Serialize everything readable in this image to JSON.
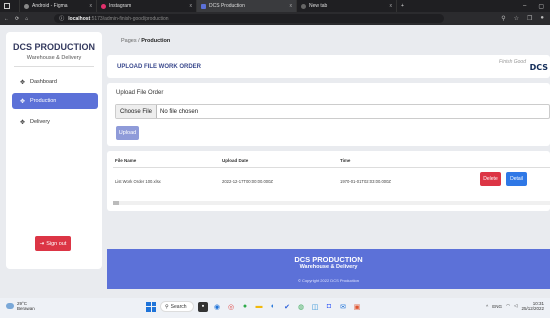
{
  "browser": {
    "tabs": [
      {
        "label": "Android - Figma",
        "close": "x",
        "color": "#888"
      },
      {
        "label": "Instagram",
        "close": "x",
        "color": "#e1306c"
      },
      {
        "label": "DCS Production",
        "close": "x",
        "color": "#5c71d8"
      },
      {
        "label": "New tab",
        "close": "x",
        "color": "#666"
      }
    ],
    "new_tab": "+",
    "url_host": "localhost",
    "url_path": ":5173/admin-finish-good/production",
    "win_minimize": "–",
    "win_maximize": "▢"
  },
  "sidebar": {
    "brand_title": "DCS PRODUCTION",
    "brand_subtitle": "Warehouse & Delivery",
    "items": [
      {
        "label": "Dashboard",
        "icon": "cube-icon"
      },
      {
        "label": "Production",
        "icon": "cube-icon"
      },
      {
        "label": "Delivery",
        "icon": "cube-icon"
      }
    ],
    "signout_label": "Sign out"
  },
  "breadcrumb": {
    "root": "Pages",
    "sep": " / ",
    "current": "Production"
  },
  "header": {
    "title": "UPLOAD FILE WORK ORDER",
    "finish_good": "Finish Good",
    "logo_text": "DCS"
  },
  "upload": {
    "label": "Upload File Order",
    "choose_button": "Choose File",
    "no_file": "No file chosen",
    "upload_button": "Upload"
  },
  "table": {
    "columns": [
      "File Name",
      "Upload Date",
      "Time"
    ],
    "rows": [
      {
        "file_name": "List Work Order 100.xlsx",
        "upload_date": "2022-12-17T00:00:00.000Z",
        "time": "1970-01-01T02:03:00.000Z"
      }
    ],
    "delete_label": "Delete",
    "detail_label": "Detail"
  },
  "footer": {
    "title": "DCS PRODUCTION",
    "subtitle": "Warehouse & Delivery",
    "copyright": "© Copyright 2022 DCS Production"
  },
  "taskbar": {
    "temp": "29°C",
    "weather": "Berawan",
    "search": "Search",
    "lang": "ENG",
    "time": "10:31",
    "date": "25/12/2022"
  }
}
